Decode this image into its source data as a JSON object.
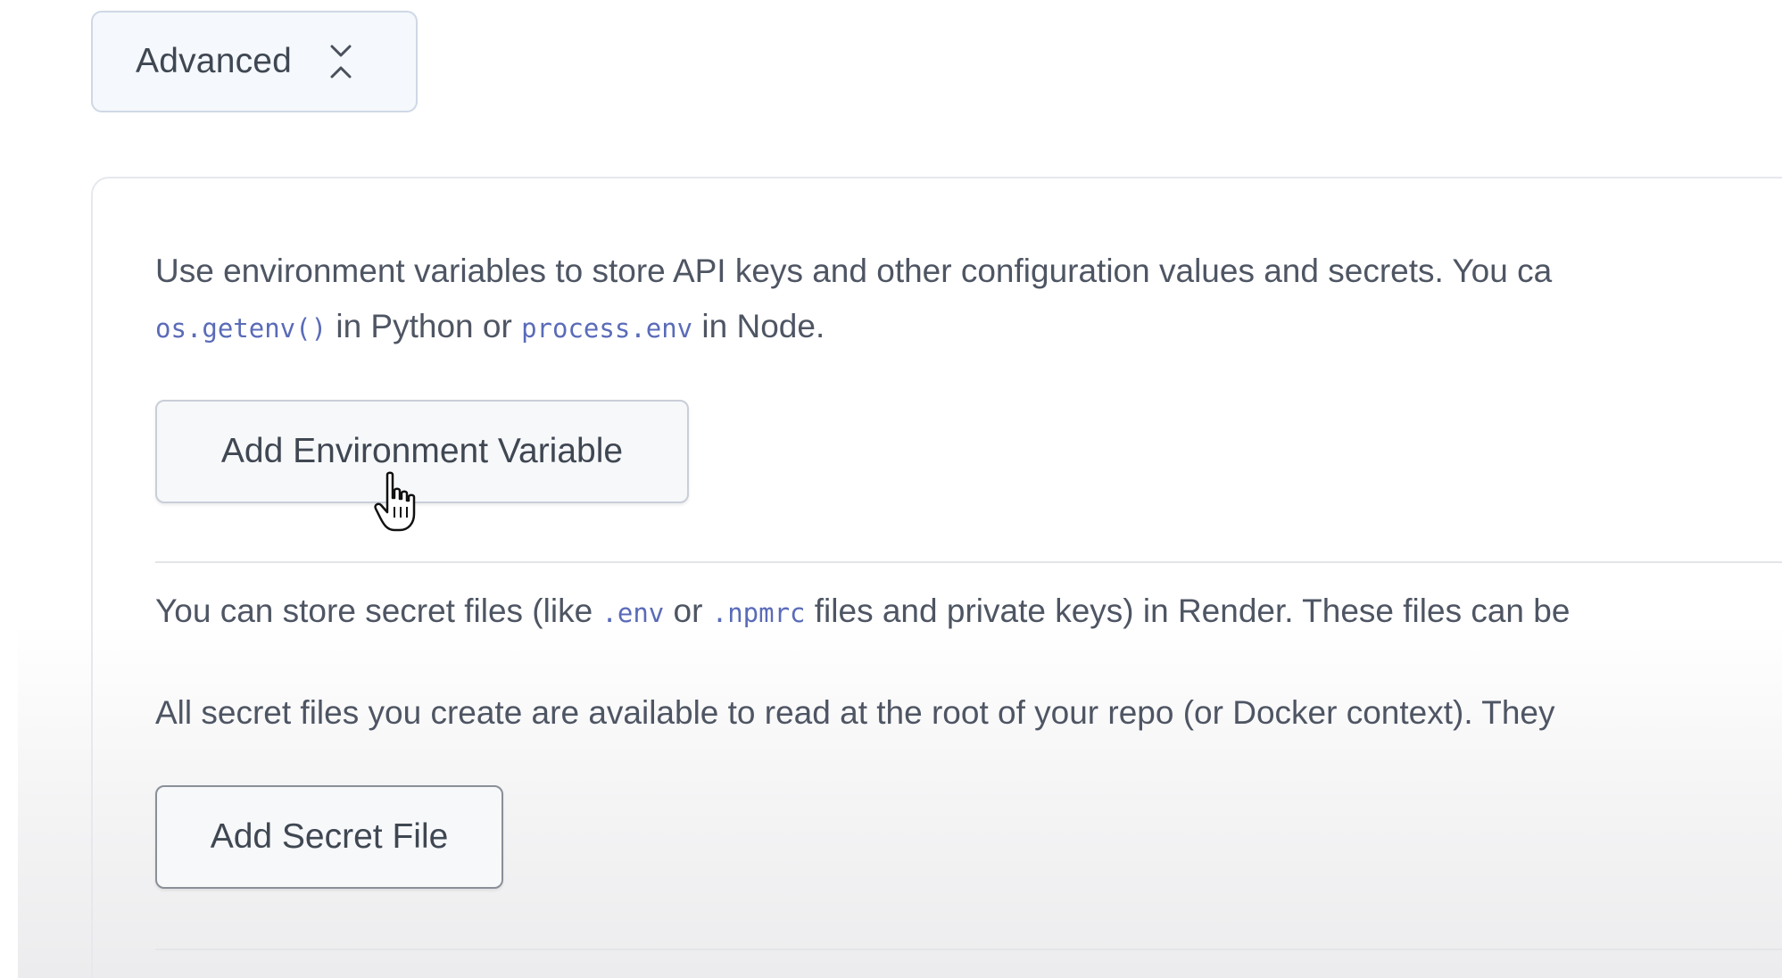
{
  "advanced": {
    "label": "Advanced",
    "icon": "chevron-collapse-icon"
  },
  "env_section": {
    "line1": "Use environment variables to store API keys and other configuration values and secrets. You ca",
    "line2_code1": "os.getenv()",
    "line2_text1": " in Python or ",
    "line2_code2": "process.env",
    "line2_text2": " in Node.",
    "button_label": "Add Environment Variable"
  },
  "secret_section": {
    "line1_text1": "You can store secret files (like ",
    "line1_code1": ".env",
    "line1_text2": " or ",
    "line1_code2": ".npmrc",
    "line1_text3": " files and private keys) in Render. These files can be",
    "line2": "All secret files you create are available to read at the root of your repo (or Docker context). They",
    "button_label": "Add Secret File"
  },
  "cursor": {
    "icon": "hand-pointer-icon"
  }
}
